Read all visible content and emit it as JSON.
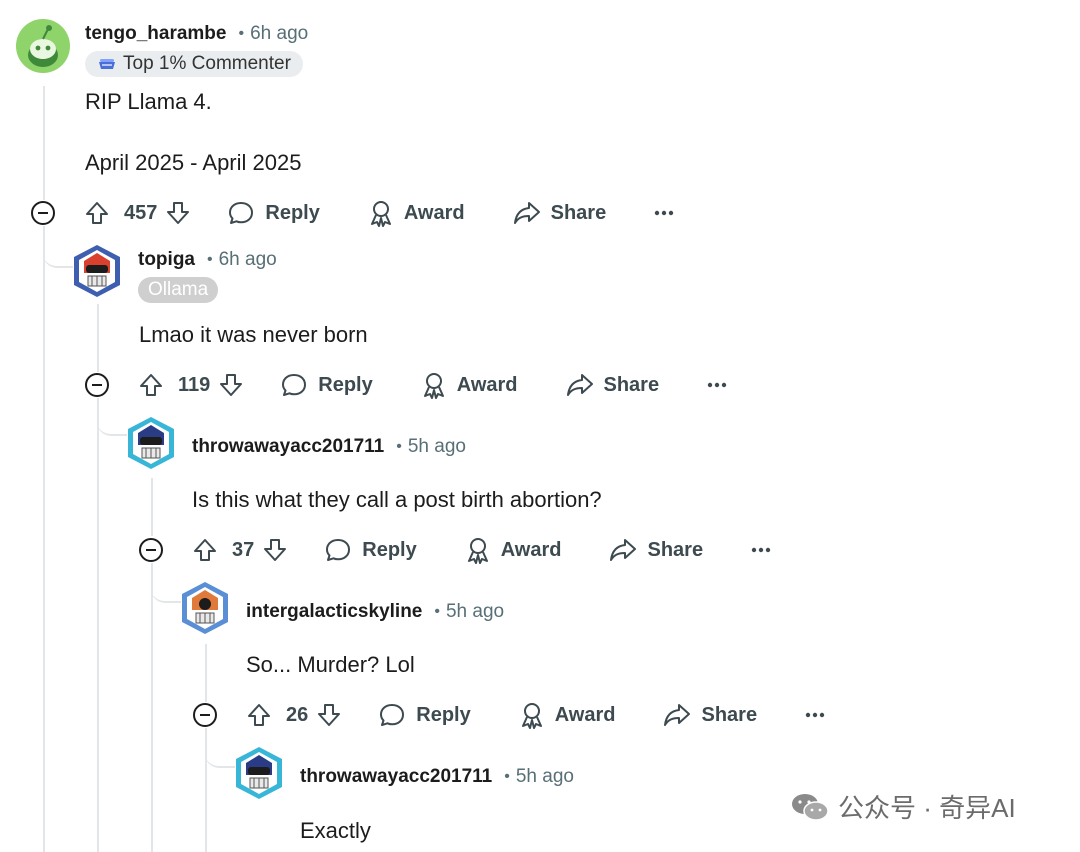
{
  "watermark": {
    "text": "公众号 · 奇异AI"
  },
  "comments": [
    {
      "username": "tengo_harambe",
      "time": "6h ago",
      "flair": "Top 1% Commenter",
      "body": [
        "RIP Llama 4.",
        "April 2025 - April 2025"
      ],
      "votes": "457",
      "actions": {
        "reply": "Reply",
        "award": "Award",
        "share": "Share"
      }
    },
    {
      "username": "topiga",
      "time": "6h ago",
      "flair": "Ollama",
      "body": [
        "Lmao it was never born"
      ],
      "votes": "119",
      "actions": {
        "reply": "Reply",
        "award": "Award",
        "share": "Share"
      }
    },
    {
      "username": "throwawayacc201711",
      "time": "5h ago",
      "body": [
        "Is this what they call a post birth abortion?"
      ],
      "votes": "37",
      "actions": {
        "reply": "Reply",
        "award": "Award",
        "share": "Share"
      }
    },
    {
      "username": "intergalacticskyline",
      "time": "5h ago",
      "body": [
        "So... Murder? Lol"
      ],
      "votes": "26",
      "actions": {
        "reply": "Reply",
        "award": "Award",
        "share": "Share"
      }
    },
    {
      "username": "throwawayacc201711",
      "time": "5h ago",
      "body": [
        "Exactly"
      ]
    }
  ]
}
